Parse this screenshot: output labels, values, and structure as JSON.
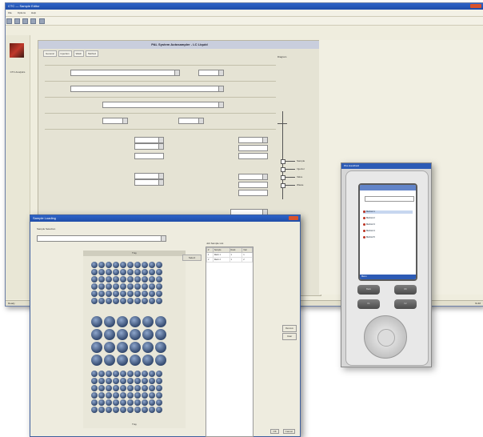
{
  "main_window": {
    "title": "CTC — Sample Editor",
    "menu": [
      "File",
      "Options",
      "Help"
    ],
    "toolbar_icons": [
      "new-icon",
      "open-icon",
      "save-icon",
      "print-icon",
      "help-icon"
    ],
    "logo_label": "CTC Analytics",
    "form_title": "PAL System Autosampler - LC Liquid",
    "tabs": [
      "General",
      "Injection",
      "Wash",
      "Method"
    ],
    "diagram_label": "Diagram",
    "diagram_labels": [
      "Sample",
      "Injector",
      "Valve",
      "Waste"
    ],
    "status_left": "Ready",
    "status_right": "NUM"
  },
  "dialog": {
    "title": "Sample Loading",
    "sample_label": "Sample Selection",
    "rack_title": "Tray",
    "rack_footer": "Tray",
    "select_button": "Select",
    "job_title": "Job Sample List",
    "job_columns": [
      "#",
      "Sample",
      "Rack",
      "Vial"
    ],
    "job_rows": [
      [
        "1",
        "Rack 1",
        "1",
        "1"
      ],
      [
        "2",
        "Rack 2",
        "1",
        "2"
      ]
    ],
    "side_buttons": [
      "Remove",
      "Clear"
    ],
    "footer_buttons": [
      "OK",
      "Cancel"
    ]
  },
  "device": {
    "title": "PAL Handheld",
    "list_items": [
      "Method 1",
      "Method 2",
      "Method 3",
      "Method 4",
      "Method 5"
    ],
    "bottom_bar": "Menu",
    "buttons": [
      "Back",
      "OK",
      "F1",
      "F2"
    ]
  }
}
